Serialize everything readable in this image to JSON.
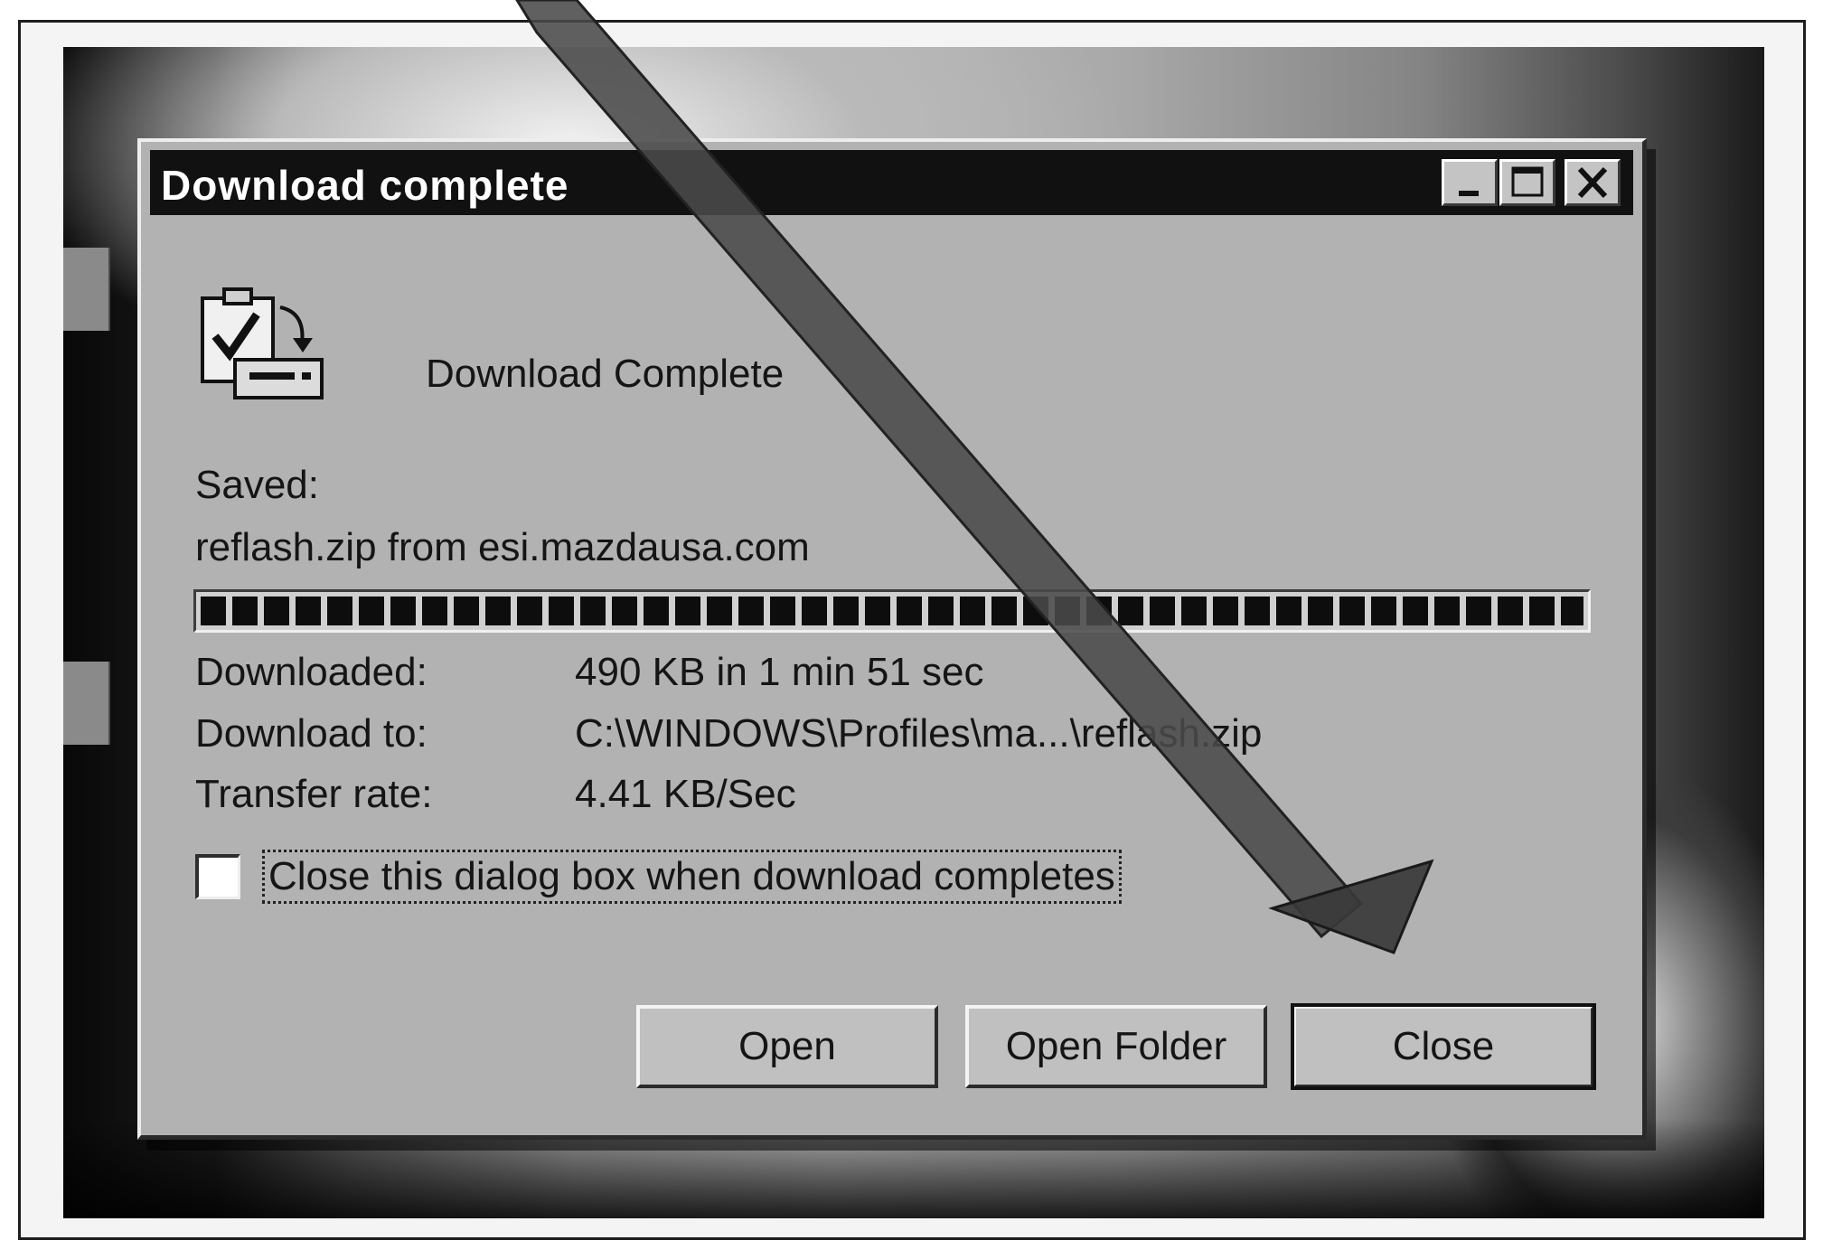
{
  "window": {
    "title": "Download complete",
    "controls": {
      "minimize": "minimize-icon",
      "maximize": "maximize-icon",
      "close": "close-icon"
    }
  },
  "body": {
    "heading": "Download Complete",
    "saved_label": "Saved:",
    "saved_value": "reflash.zip from esi.mazdausa.com",
    "progress_fraction": 1.0,
    "details": {
      "downloaded_label": "Downloaded:",
      "downloaded_value": "490 KB in 1 min 51 sec",
      "download_to_label": "Download to:",
      "download_to_value": "C:\\WINDOWS\\Profiles\\ma...\\reflash.zip",
      "transfer_rate_label": "Transfer rate:",
      "transfer_rate_value": "4.41 KB/Sec"
    },
    "checkbox": {
      "label": "Close this dialog box when download completes",
      "checked": false
    }
  },
  "buttons": {
    "open_label": "Open",
    "open_folder_label": "Open Folder",
    "close_label": "Close"
  },
  "annotation": {
    "arrow_target": "close-button",
    "icon": "arrow-icon"
  },
  "colors": {
    "titlebar": "#111111",
    "dialog_face": "#b2b2b2",
    "progress_block": "#0d0d0d"
  }
}
